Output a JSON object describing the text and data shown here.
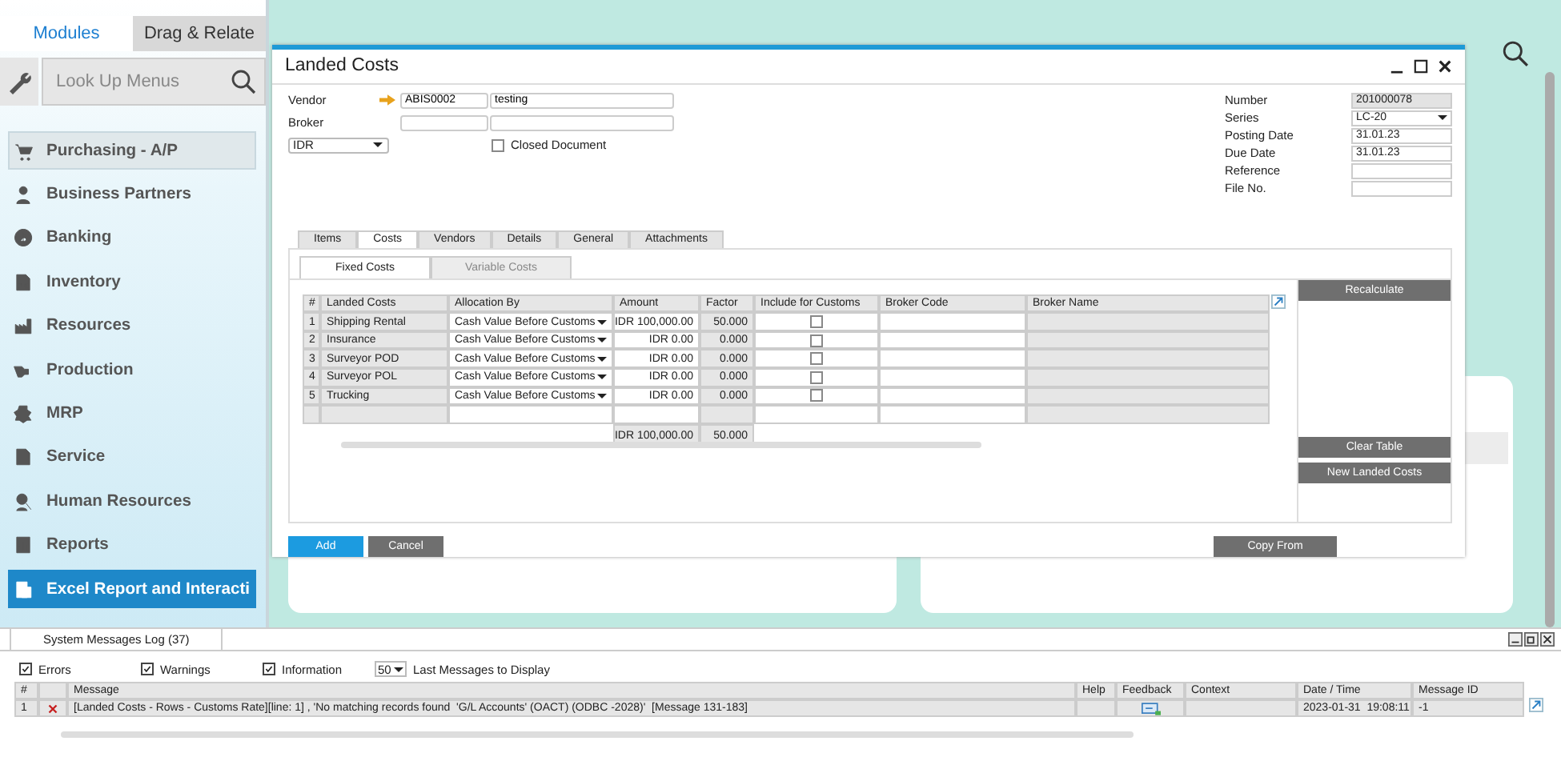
{
  "sidebar": {
    "tabs": [
      {
        "label": "Modules",
        "selected": true
      },
      {
        "label": "Drag & Relate",
        "selected": false
      }
    ],
    "search": {
      "placeholder": "Look Up Menus"
    },
    "items": [
      {
        "label": "Purchasing - A/P",
        "selected": false,
        "highlighted": true
      },
      {
        "label": "Business Partners",
        "selected": false,
        "highlighted": false
      },
      {
        "label": "Banking",
        "selected": false,
        "highlighted": false
      },
      {
        "label": "Inventory",
        "selected": false,
        "highlighted": false
      },
      {
        "label": "Resources",
        "selected": false,
        "highlighted": false
      },
      {
        "label": "Production",
        "selected": false,
        "highlighted": false
      },
      {
        "label": "MRP",
        "selected": false,
        "highlighted": false
      },
      {
        "label": "Service",
        "selected": false,
        "highlighted": false
      },
      {
        "label": "Human Resources",
        "selected": false,
        "highlighted": false
      },
      {
        "label": "Reports",
        "selected": false,
        "highlighted": false
      },
      {
        "label": "Excel Report and Interacti",
        "selected": true,
        "highlighted": false
      }
    ]
  },
  "dialog": {
    "title": "Landed Costs",
    "vendor": {
      "label": "Vendor",
      "code": "ABIS0002",
      "name": "testing"
    },
    "broker": {
      "label": "Broker"
    },
    "currency": "IDR",
    "closed_document": {
      "label": "Closed Document",
      "checked": false
    },
    "header_fields": [
      {
        "label": "Number",
        "value": "201000078",
        "kind": "readonly"
      },
      {
        "label": "Series",
        "value": "LC-20",
        "kind": "dropdown"
      },
      {
        "label": "Posting Date",
        "value": "31.01.23",
        "kind": "text"
      },
      {
        "label": "Due Date",
        "value": "31.01.23",
        "kind": "text"
      },
      {
        "label": "Reference",
        "kind": "text"
      },
      {
        "label": "File No.",
        "kind": "text"
      }
    ],
    "tabs": [
      {
        "label": "Items",
        "selected": false
      },
      {
        "label": "Costs",
        "selected": true
      },
      {
        "label": "Vendors",
        "selected": false
      },
      {
        "label": "Details",
        "selected": false
      },
      {
        "label": "General",
        "selected": false
      },
      {
        "label": "Attachments",
        "selected": false
      }
    ],
    "subtabs": [
      {
        "label": "Fixed Costs",
        "selected": true
      },
      {
        "label": "Variable Costs",
        "selected": false
      }
    ],
    "table": {
      "columns": [
        "#",
        "Landed Costs",
        "Allocation By",
        "Amount",
        "Factor",
        "Include for Customs",
        "Broker Code",
        "Broker Name"
      ],
      "rows": [
        {
          "num": "1",
          "name": "Shipping Rental",
          "allocation": "Cash Value Before Customs",
          "amount": "IDR 100,000.00",
          "factor": "50.000",
          "include": false
        },
        {
          "num": "2",
          "name": "Insurance",
          "allocation": "Cash Value Before Customs",
          "amount": "IDR 0.00",
          "factor": "0.000",
          "include": false
        },
        {
          "num": "3",
          "name": "Surveyor POD",
          "allocation": "Cash Value Before Customs",
          "amount": "IDR 0.00",
          "factor": "0.000",
          "include": false
        },
        {
          "num": "4",
          "name": "Surveyor POL",
          "allocation": "Cash Value Before Customs",
          "amount": "IDR 0.00",
          "factor": "0.000",
          "include": false
        },
        {
          "num": "5",
          "name": "Trucking",
          "allocation": "Cash Value Before Customs",
          "amount": "IDR 0.00",
          "factor": "0.000",
          "include": false
        }
      ],
      "totals": {
        "amount": "IDR 100,000.00",
        "factor": "50.000"
      }
    },
    "side_buttons": [
      "Recalculate",
      "Clear Table",
      "New Landed Costs"
    ],
    "buttons": {
      "add": "Add",
      "cancel": "Cancel",
      "copy_from": "Copy From"
    }
  },
  "log": {
    "title": "System Messages Log (37)",
    "filters": [
      {
        "label": "Errors",
        "checked": true
      },
      {
        "label": "Warnings",
        "checked": true
      },
      {
        "label": "Information",
        "checked": true
      }
    ],
    "count": "50",
    "count_label": "Last Messages to Display",
    "columns": [
      "#",
      "Message",
      "Help",
      "Feedback",
      "Context",
      "Date / Time",
      "Message ID"
    ],
    "rows": [
      {
        "num": "1",
        "kind": "error",
        "message": "[Landed Costs - Rows - Customs Rate][line: 1] , 'No matching records found  'G/L Accounts' (OACT) (ODBC -2028)'  [Message 131-183]",
        "date": "2023-01-31  19:08:11",
        "id": "-1"
      }
    ]
  }
}
